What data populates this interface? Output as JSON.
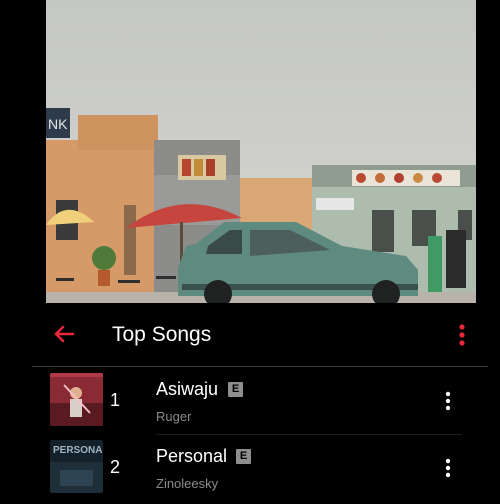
{
  "hero": {
    "video_icon": "music-video-still"
  },
  "header": {
    "back_icon": "back-arrow-icon",
    "title": "Top Songs",
    "menu_icon": "more-vertical-icon",
    "accent_color": "#e8283a"
  },
  "songs": [
    {
      "rank": "1",
      "title": "Asiwaju",
      "explicit": "E",
      "artist": "Ruger"
    },
    {
      "rank": "2",
      "title": "Personal",
      "explicit": "E",
      "artist": "Zinoleesky"
    }
  ]
}
